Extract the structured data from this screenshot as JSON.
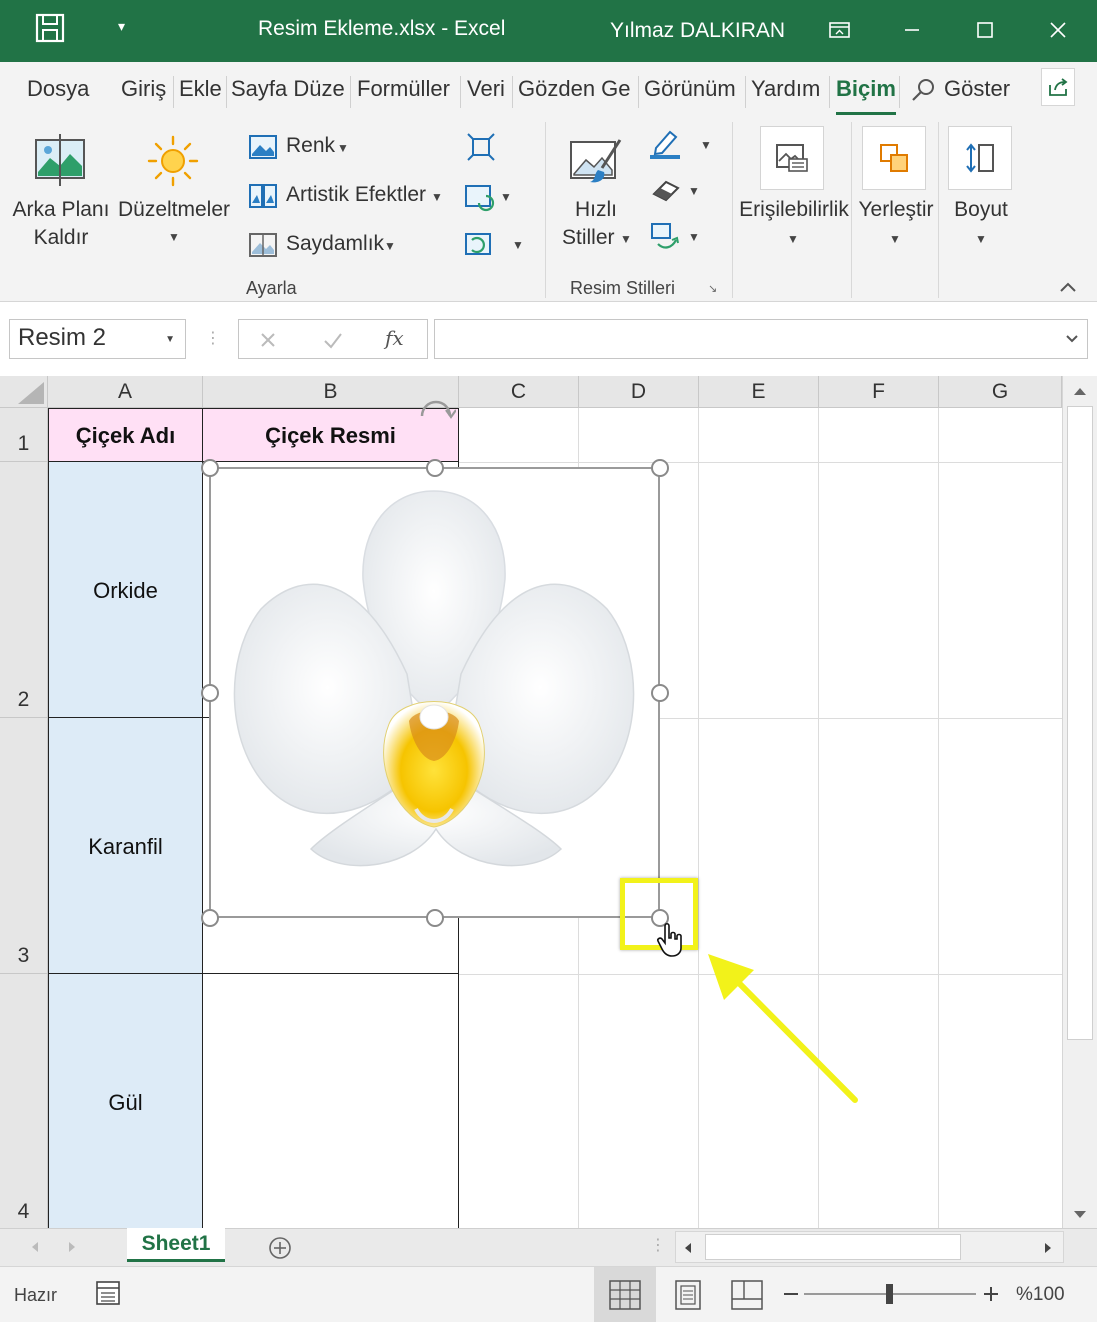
{
  "titlebar": {
    "doc_title": "Resim Ekleme.xlsx  -  Excel",
    "user": "Yılmaz DALKIRAN",
    "qat_caret": "▾"
  },
  "tabs": [
    "Dosya",
    "Giriş",
    "Ekle",
    "Sayfa Düzei",
    "Formüller",
    "Veri",
    "Gözden Ge",
    "Görünüm",
    "Yardım",
    "Biçim"
  ],
  "active_tab": "Biçim",
  "tell_me": "Göster",
  "ribbon": {
    "remove_bg": [
      "Arka Planı",
      "Kaldır"
    ],
    "corrections": "Düzeltmeler",
    "color": "Renk",
    "artistic": "Artistik Efektler",
    "transparency": "Saydamlık",
    "adjust_group": "Ayarla",
    "quick_styles": [
      "Hızlı",
      "Stiller"
    ],
    "styles_group": "Resim Stilleri",
    "accessibility": "Erişilebilirlik",
    "arrange": "Yerleştir",
    "size": "Boyut"
  },
  "formula_bar": {
    "name_box": "Resim 2",
    "fx": "fx",
    "value": ""
  },
  "columns": [
    "A",
    "B",
    "C",
    "D",
    "E",
    "F",
    "G"
  ],
  "rows": [
    "1",
    "2",
    "3",
    "4"
  ],
  "cells": {
    "A1": "Çiçek Adı",
    "B1": "Çiçek Resmi",
    "A2": "Orkide",
    "A3": "Karanfil",
    "A4": "Gül"
  },
  "sheet_tab": "Sheet1",
  "status": {
    "ready": "Hazır",
    "zoom": "%100"
  },
  "colors": {
    "excel_green": "#217346",
    "header_pink": "#ffe0f5",
    "label_blue": "#ddebf7",
    "highlight_yellow": "#f2f21a"
  }
}
